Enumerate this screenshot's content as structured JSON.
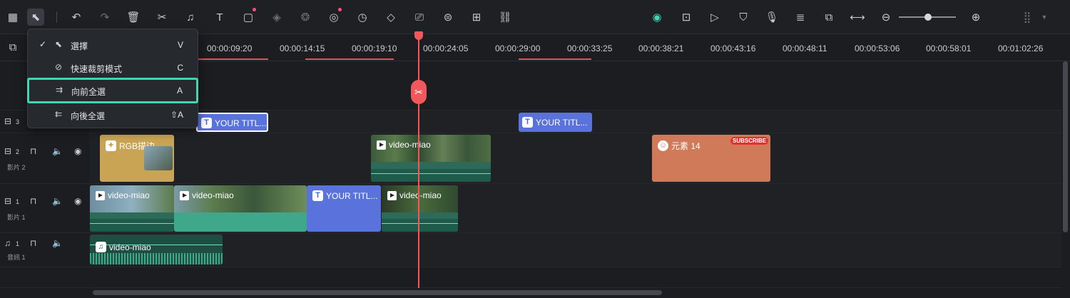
{
  "timecodes": [
    "00:00:09:20",
    "00:00:14:15",
    "00:00:19:10",
    "00:00:24:05",
    "00:00:29:00",
    "00:00:33:25",
    "00:00:38:21",
    "00:00:43:16",
    "00:00:48:11",
    "00:00:53:06",
    "00:00:58:01",
    "00:01:02:26"
  ],
  "menu": {
    "items": [
      {
        "label": "選擇",
        "shortcut": "V",
        "checked": "✓"
      },
      {
        "label": "快速裁剪模式",
        "shortcut": "C",
        "checked": ""
      },
      {
        "label": "向前全選",
        "shortcut": "A",
        "checked": ""
      },
      {
        "label": "向後全選",
        "shortcut": "⇧A",
        "checked": ""
      }
    ]
  },
  "tracks": {
    "t3": {
      "num": "3",
      "name": ""
    },
    "t2": {
      "num": "2",
      "name": "影片 2"
    },
    "t1": {
      "num": "1",
      "name": "影片 1"
    },
    "a1": {
      "num": "1",
      "name": "音訊 1"
    }
  },
  "clips": {
    "title1": "YOUR TITL...",
    "title2": "YOUR TITL...",
    "title3": "YOUR TITL...",
    "rgb": "RGB描边",
    "video_t2": "video-miao",
    "element": "元素 14",
    "subscribe": "SUBSCRIBE",
    "v1a": "video-miao",
    "v1b": "video-miao",
    "v1c": "video-miao",
    "audio": "video-miao"
  },
  "colors": {
    "accent": "#3fd6b0",
    "playhead": "#f0585b",
    "title_clip": "#5a73dc",
    "element_clip": "#d07a5a"
  }
}
